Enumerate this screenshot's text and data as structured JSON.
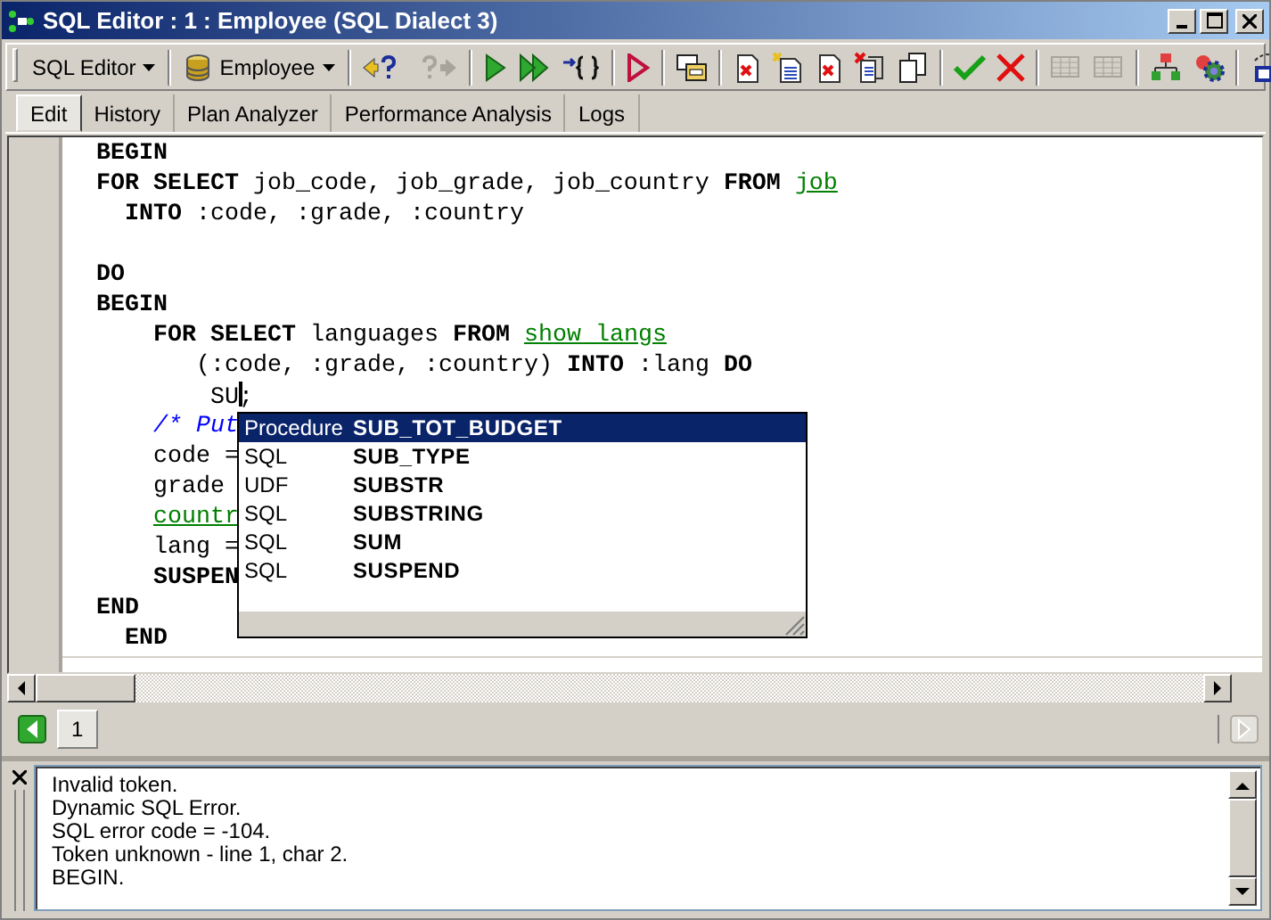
{
  "window": {
    "title": "SQL Editor : 1 : Employee (SQL Dialect 3)"
  },
  "toolbar": {
    "items": [
      {
        "kind": "dropdown",
        "label": "SQL Editor",
        "disabled": false
      },
      {
        "kind": "sep"
      },
      {
        "kind": "database-dropdown",
        "label": "Employee",
        "disabled": false
      },
      {
        "kind": "sep"
      },
      {
        "kind": "prepare",
        "disabled": false
      },
      {
        "kind": "next",
        "disabled": true
      },
      {
        "kind": "sep"
      },
      {
        "kind": "run",
        "disabled": false
      },
      {
        "kind": "run-all",
        "disabled": false
      },
      {
        "kind": "braces",
        "disabled": false
      },
      {
        "kind": "sep"
      },
      {
        "kind": "debug",
        "disabled": false
      },
      {
        "kind": "sep"
      },
      {
        "kind": "windows",
        "disabled": false
      },
      {
        "kind": "sep"
      },
      {
        "kind": "doc-x",
        "disabled": false
      },
      {
        "kind": "doc-new",
        "disabled": false
      },
      {
        "kind": "doc-x",
        "disabled": false
      },
      {
        "kind": "doc-x2",
        "disabled": false
      },
      {
        "kind": "copy",
        "disabled": false
      },
      {
        "kind": "sep"
      },
      {
        "kind": "commit",
        "disabled": false
      },
      {
        "kind": "rollback",
        "disabled": false
      },
      {
        "kind": "sep"
      },
      {
        "kind": "grid",
        "disabled": true
      },
      {
        "kind": "grid",
        "disabled": true
      },
      {
        "kind": "sep"
      },
      {
        "kind": "tree",
        "disabled": false
      },
      {
        "kind": "gear",
        "disabled": false
      },
      {
        "kind": "sep"
      },
      {
        "kind": "select",
        "disabled": false
      }
    ]
  },
  "tabs": [
    {
      "label": "Edit",
      "selected": true
    },
    {
      "label": "History",
      "selected": false
    },
    {
      "label": "Plan Analyzer",
      "selected": false
    },
    {
      "label": "Performance Analysis",
      "selected": false
    },
    {
      "label": "Logs",
      "selected": false
    }
  ],
  "editor": {
    "lines": [
      {
        "tokens": [
          {
            "kind": "keyword",
            "text": "BEGIN"
          }
        ]
      },
      {
        "tokens": [
          {
            "kind": "keyword",
            "text": "FOR SELECT"
          },
          {
            "kind": "plain",
            "text": " job_code, job_grade, job_country "
          },
          {
            "kind": "keyword",
            "text": "FROM "
          },
          {
            "kind": "link",
            "text": "job"
          }
        ]
      },
      {
        "tokens": [
          {
            "kind": "keyword",
            "text": "  INTO"
          },
          {
            "kind": "plain",
            "text": " :code, :grade, :country"
          }
        ]
      },
      {
        "kind": "blank"
      },
      {
        "tokens": [
          {
            "kind": "keyword",
            "text": "DO"
          }
        ]
      },
      {
        "tokens": [
          {
            "kind": "keyword",
            "text": "BEGIN"
          }
        ]
      },
      {
        "tokens": [
          {
            "kind": "keyword",
            "text": "    FOR SELECT"
          },
          {
            "kind": "plain",
            "text": " languages "
          },
          {
            "kind": "keyword",
            "text": "FROM "
          },
          {
            "kind": "link",
            "text": "show langs"
          }
        ]
      },
      {
        "tokens": [
          {
            "kind": "plain",
            "text": "       (:code, :grade, :country) "
          },
          {
            "kind": "keyword",
            "text": "INTO"
          },
          {
            "kind": "plain",
            "text": " :lang "
          },
          {
            "kind": "keyword",
            "text": "DO"
          }
        ]
      },
      {
        "tokens": [
          {
            "kind": "plain",
            "text": "        SU"
          },
          {
            "kind": "caret"
          },
          {
            "kind": "plain",
            "text": ";"
          }
        ]
      },
      {
        "tokens": [
          {
            "kind": "comment",
            "text": "    /* Put"
          }
        ]
      },
      {
        "tokens": [
          {
            "kind": "plain",
            "text": "    code ="
          }
        ]
      },
      {
        "tokens": [
          {
            "kind": "plain",
            "text": "    grade"
          }
        ]
      },
      {
        "tokens": [
          {
            "kind": "link",
            "text": "    countr"
          }
        ]
      },
      {
        "tokens": [
          {
            "kind": "plain",
            "text": "    lang ="
          }
        ]
      },
      {
        "tokens": [
          {
            "kind": "keyword",
            "text": "    SUSPEN"
          }
        ]
      },
      {
        "tokens": [
          {
            "kind": "keyword",
            "text": "END"
          }
        ]
      },
      {
        "tokens": [
          {
            "kind": "keyword",
            "text": "  END"
          }
        ]
      }
    ]
  },
  "completion": {
    "items": [
      {
        "category": "Procedure",
        "name": "SUB_TOT_BUDGET",
        "selected": true
      },
      {
        "category": "SQL",
        "name": "SUB_TYPE",
        "selected": false
      },
      {
        "category": "UDF",
        "name": "SUBSTR",
        "selected": false
      },
      {
        "category": "SQL",
        "name": "SUBSTRING",
        "selected": false
      },
      {
        "category": "SQL",
        "name": "SUM",
        "selected": false
      },
      {
        "category": "SQL",
        "name": "SUSPEND",
        "selected": false
      }
    ]
  },
  "pages": {
    "tabs": [
      {
        "label": "1",
        "selected": true
      }
    ],
    "next_disabled": true
  },
  "messages": {
    "lines": [
      "Invalid token.",
      "Dynamic SQL Error.",
      "SQL error code = -104.",
      "Token unknown - line 1, char 2.",
      "BEGIN."
    ]
  }
}
